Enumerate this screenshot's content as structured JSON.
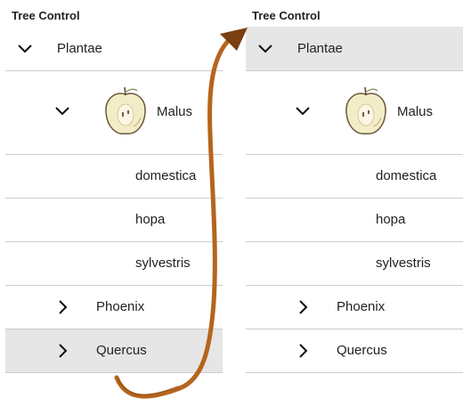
{
  "panels": [
    {
      "title": "Tree Control",
      "root": {
        "label": "Plantae",
        "expanded": true,
        "selected": false
      },
      "malus": {
        "label": "Malus",
        "expanded": true,
        "icon": "apple-icon"
      },
      "leaves": [
        "domestica",
        "hopa",
        "sylvestris"
      ],
      "phoenix": {
        "label": "Phoenix",
        "expanded": false
      },
      "quercus": {
        "label": "Quercus",
        "expanded": false,
        "selected": true
      }
    },
    {
      "title": "Tree Control",
      "root": {
        "label": "Plantae",
        "expanded": true,
        "selected": true
      },
      "malus": {
        "label": "Malus",
        "expanded": true,
        "icon": "apple-icon"
      },
      "leaves": [
        "domestica",
        "hopa",
        "sylvestris"
      ],
      "phoenix": {
        "label": "Phoenix",
        "expanded": false
      },
      "quercus": {
        "label": "Quercus",
        "expanded": false,
        "selected": false
      }
    }
  ],
  "colors": {
    "selected_row": "#e6e6e6",
    "divider": "#cccccc",
    "arrow": "#b5651d"
  }
}
